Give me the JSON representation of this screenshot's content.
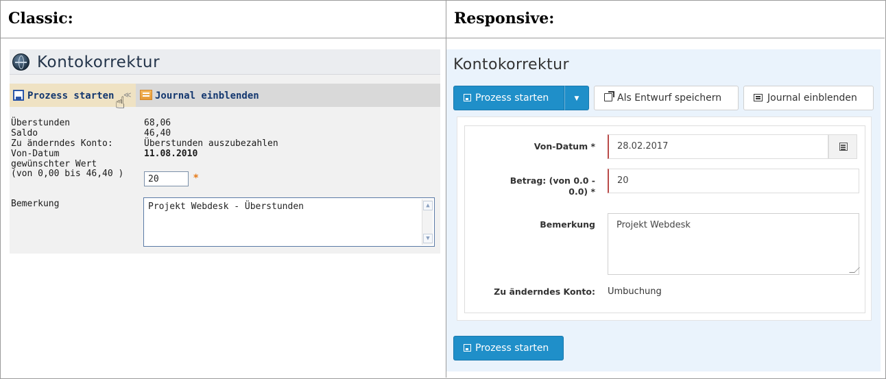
{
  "headers": {
    "classic": "Classic:",
    "responsive": "Responsive:"
  },
  "classic": {
    "title": "Kontokorrektur",
    "toolbar": {
      "start_label": "Prozess starten",
      "journal_label": "Journal einblenden"
    },
    "fields": [
      {
        "label": "Überstunden",
        "value": "68,06"
      },
      {
        "label": "Saldo",
        "value": "46,40"
      },
      {
        "label": "Zu änderndes Konto:",
        "value": "Überstunden auszubezahlen"
      },
      {
        "label": "Von-Datum",
        "value": "11.08.2010"
      }
    ],
    "wert": {
      "label_line1": "gewünschter Wert",
      "label_line2": "(von 0,00  bis 46,40 )",
      "value": "20",
      "required_mark": "*"
    },
    "bemerkung": {
      "label": "Bemerkung",
      "value": "Projekt Webdesk - Überstunden"
    }
  },
  "responsive": {
    "title": "Kontokorrektur",
    "buttons": {
      "start": "Prozess starten",
      "draft": "Als Entwurf speichern",
      "journal": "Journal einblenden",
      "start_bottom": "Prozess starten"
    },
    "form": {
      "von_datum": {
        "label": "Von-Datum *",
        "value": "28.02.2017"
      },
      "betrag": {
        "label_line1": "Betrag: (von 0.0 -",
        "label_line2": "0.0) *",
        "value": "20"
      },
      "bemerkung": {
        "label": "Bemerkung",
        "value": "Projekt Webdesk"
      },
      "konto": {
        "label": "Zu änderndes Konto:",
        "value": "Umbuchung"
      }
    }
  },
  "colors": {
    "primary": "#1f8fc9",
    "classic_link": "#13376f",
    "required": "#e67a17",
    "invalid_border": "#b94a48",
    "responsive_bg": "#eaf3fc"
  }
}
